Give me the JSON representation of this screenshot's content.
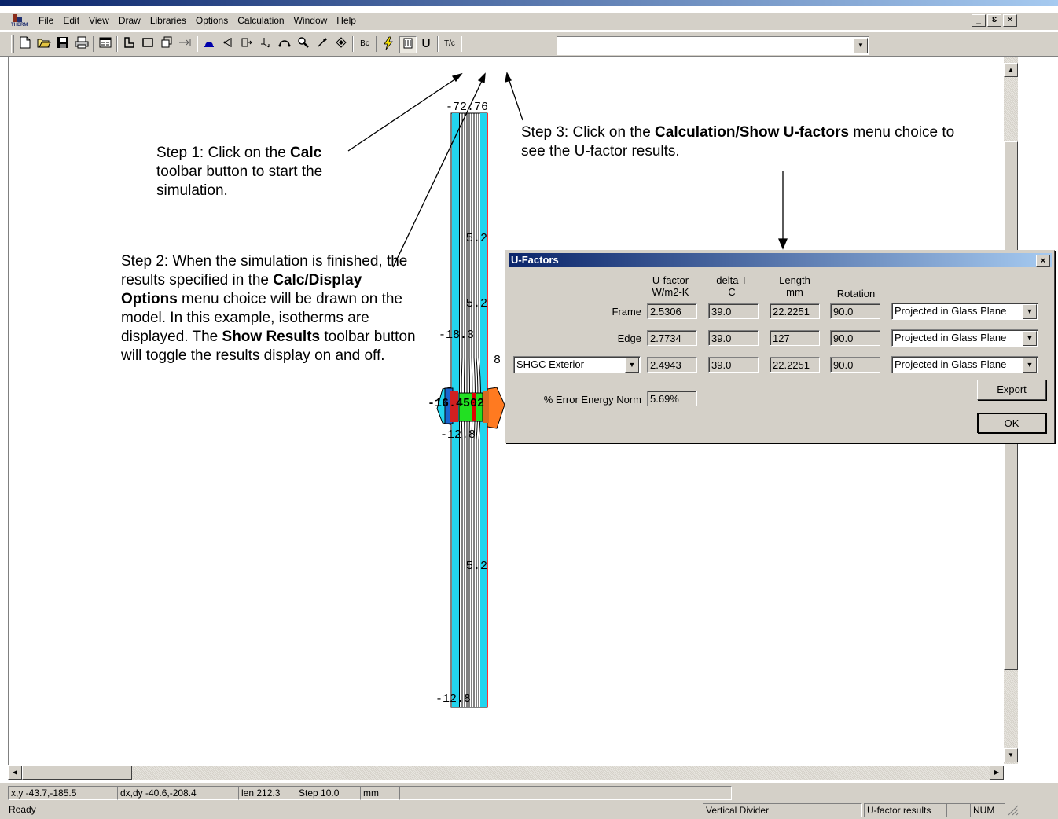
{
  "menubar": {
    "items": [
      "File",
      "Edit",
      "View",
      "Draw",
      "Libraries",
      "Options",
      "Calculation",
      "Window",
      "Help"
    ],
    "mdi_buttons": [
      "_",
      "Ɛ",
      "×"
    ]
  },
  "toolbar": {
    "icons": [
      "new-file-icon",
      "open-folder-icon",
      "save-icon",
      "print-icon",
      "properties-icon",
      "polygon-draw-icon",
      "rectangle-icon",
      "copy-icon",
      "dimension-icon",
      "fill-icon",
      "locate-point-icon",
      "insert-point-icon",
      "move-point-icon",
      "arc-icon",
      "zoom-icon",
      "eyedropper-icon",
      "rotate-icon",
      "boundary-condition-icon",
      "calc-icon",
      "show-results-icon",
      "u-factor-icon",
      "temperature-icon"
    ],
    "glyphs": {
      "bc": "Bc",
      "u": "U",
      "tc": "T/c"
    }
  },
  "annotations": {
    "step1": {
      "pre": "Step 1: Click on the ",
      "bold": "Calc",
      "post": " toolbar button to start the simulation."
    },
    "step2": {
      "pre": "Step 2: When the simulation is finished, the results specified in the ",
      "bold1": "Calc/Display Options",
      "mid": " menu choice will be drawn on the model. In this example, isotherms are displayed. The ",
      "bold2": "Show Results",
      "post": " toolbar button will toggle the results display on and off."
    },
    "step3": {
      "pre": "Step 3: Click on the ",
      "bold": "Calculation/Show U-factors",
      "post": " menu choice to see the U-factor results."
    }
  },
  "model_labels": {
    "top": "-72.76",
    "upper_mid": "5.2",
    "mid": "5.2",
    "left1": "-18.3",
    "right_small": "8",
    "center": "-16.4502",
    "lower1": "-12.8",
    "lower_mid": "5.2",
    "bottom": "-12.8"
  },
  "dialog": {
    "title": "U-Factors",
    "close": "×",
    "headers": {
      "ufactor": [
        "U-factor",
        "W/m2-K"
      ],
      "delta": [
        "delta T",
        "C"
      ],
      "length": [
        "Length",
        "mm"
      ],
      "rotation": "Rotation"
    },
    "rows": [
      {
        "label": "Frame",
        "ufactor": "2.5306",
        "delta": "39.0",
        "length": "22.2251",
        "rotation": "90.0",
        "projection": "Projected in Glass Plane"
      },
      {
        "label": "Edge",
        "ufactor": "2.7734",
        "delta": "39.0",
        "length": "127",
        "rotation": "90.0",
        "projection": "Projected in Glass Plane"
      },
      {
        "label": "SHGC Exterior",
        "ufactor": "2.4943",
        "delta": "39.0",
        "length": "22.2251",
        "rotation": "90.0",
        "projection": "Projected in Glass Plane"
      }
    ],
    "error_label": "% Error Energy Norm",
    "error_value": "5.69%",
    "export_label": "Export",
    "ok_label": "OK"
  },
  "statusbar": {
    "xy": "x,y -43.7,-185.5",
    "dxdy": "dx,dy -40.6,-208.4",
    "len": "len 212.3",
    "step": "Step 10.0",
    "units": "mm",
    "ready": "Ready",
    "mode": "Vertical Divider",
    "results": "U-factor results",
    "num": "NUM"
  }
}
